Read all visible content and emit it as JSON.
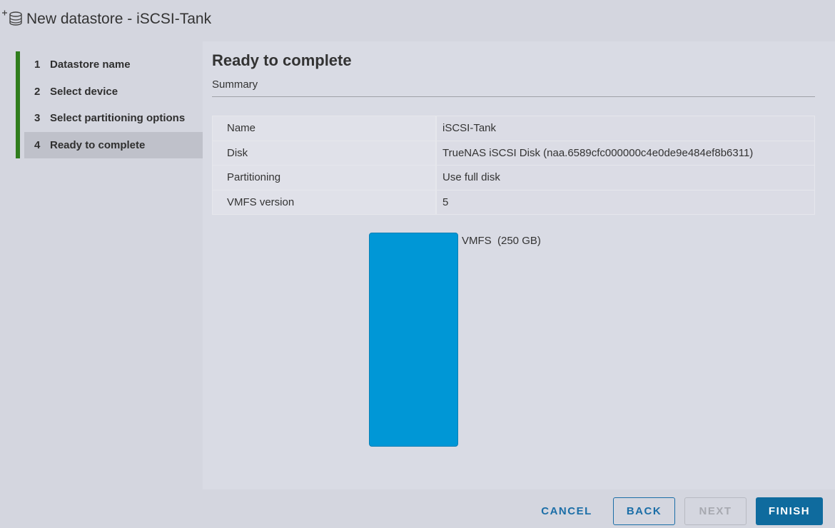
{
  "window": {
    "title": "New datastore - iSCSI-Tank",
    "icon": "new-datastore-icon"
  },
  "sidebar": {
    "steps": [
      {
        "number": "1",
        "label": "Datastore name"
      },
      {
        "number": "2",
        "label": "Select device"
      },
      {
        "number": "3",
        "label": "Select partitioning options"
      },
      {
        "number": "4",
        "label": "Ready to complete"
      }
    ],
    "active_step": 4
  },
  "main": {
    "title": "Ready to complete",
    "section": "Summary",
    "summary": [
      {
        "key": "Name",
        "value": "iSCSI-Tank"
      },
      {
        "key": "Disk",
        "value": "TrueNAS iSCSI Disk (naa.6589cfc000000c4e0de9e484ef8b6311)"
      },
      {
        "key": "Partitioning",
        "value": "Use full disk"
      },
      {
        "key": "VMFS version",
        "value": "5"
      }
    ],
    "disk_layout": {
      "label": "VMFS  (250 GB)",
      "fill_fraction": 1.0,
      "color": "#0097d6"
    }
  },
  "footer": {
    "cancel_label": "CANCEL",
    "back_label": "BACK",
    "next_label": "NEXT",
    "finish_label": "FINISH"
  },
  "colors": {
    "accent_step": "#2f7d1d",
    "primary_button": "#0f6b9e",
    "link": "#1b6ea7"
  }
}
